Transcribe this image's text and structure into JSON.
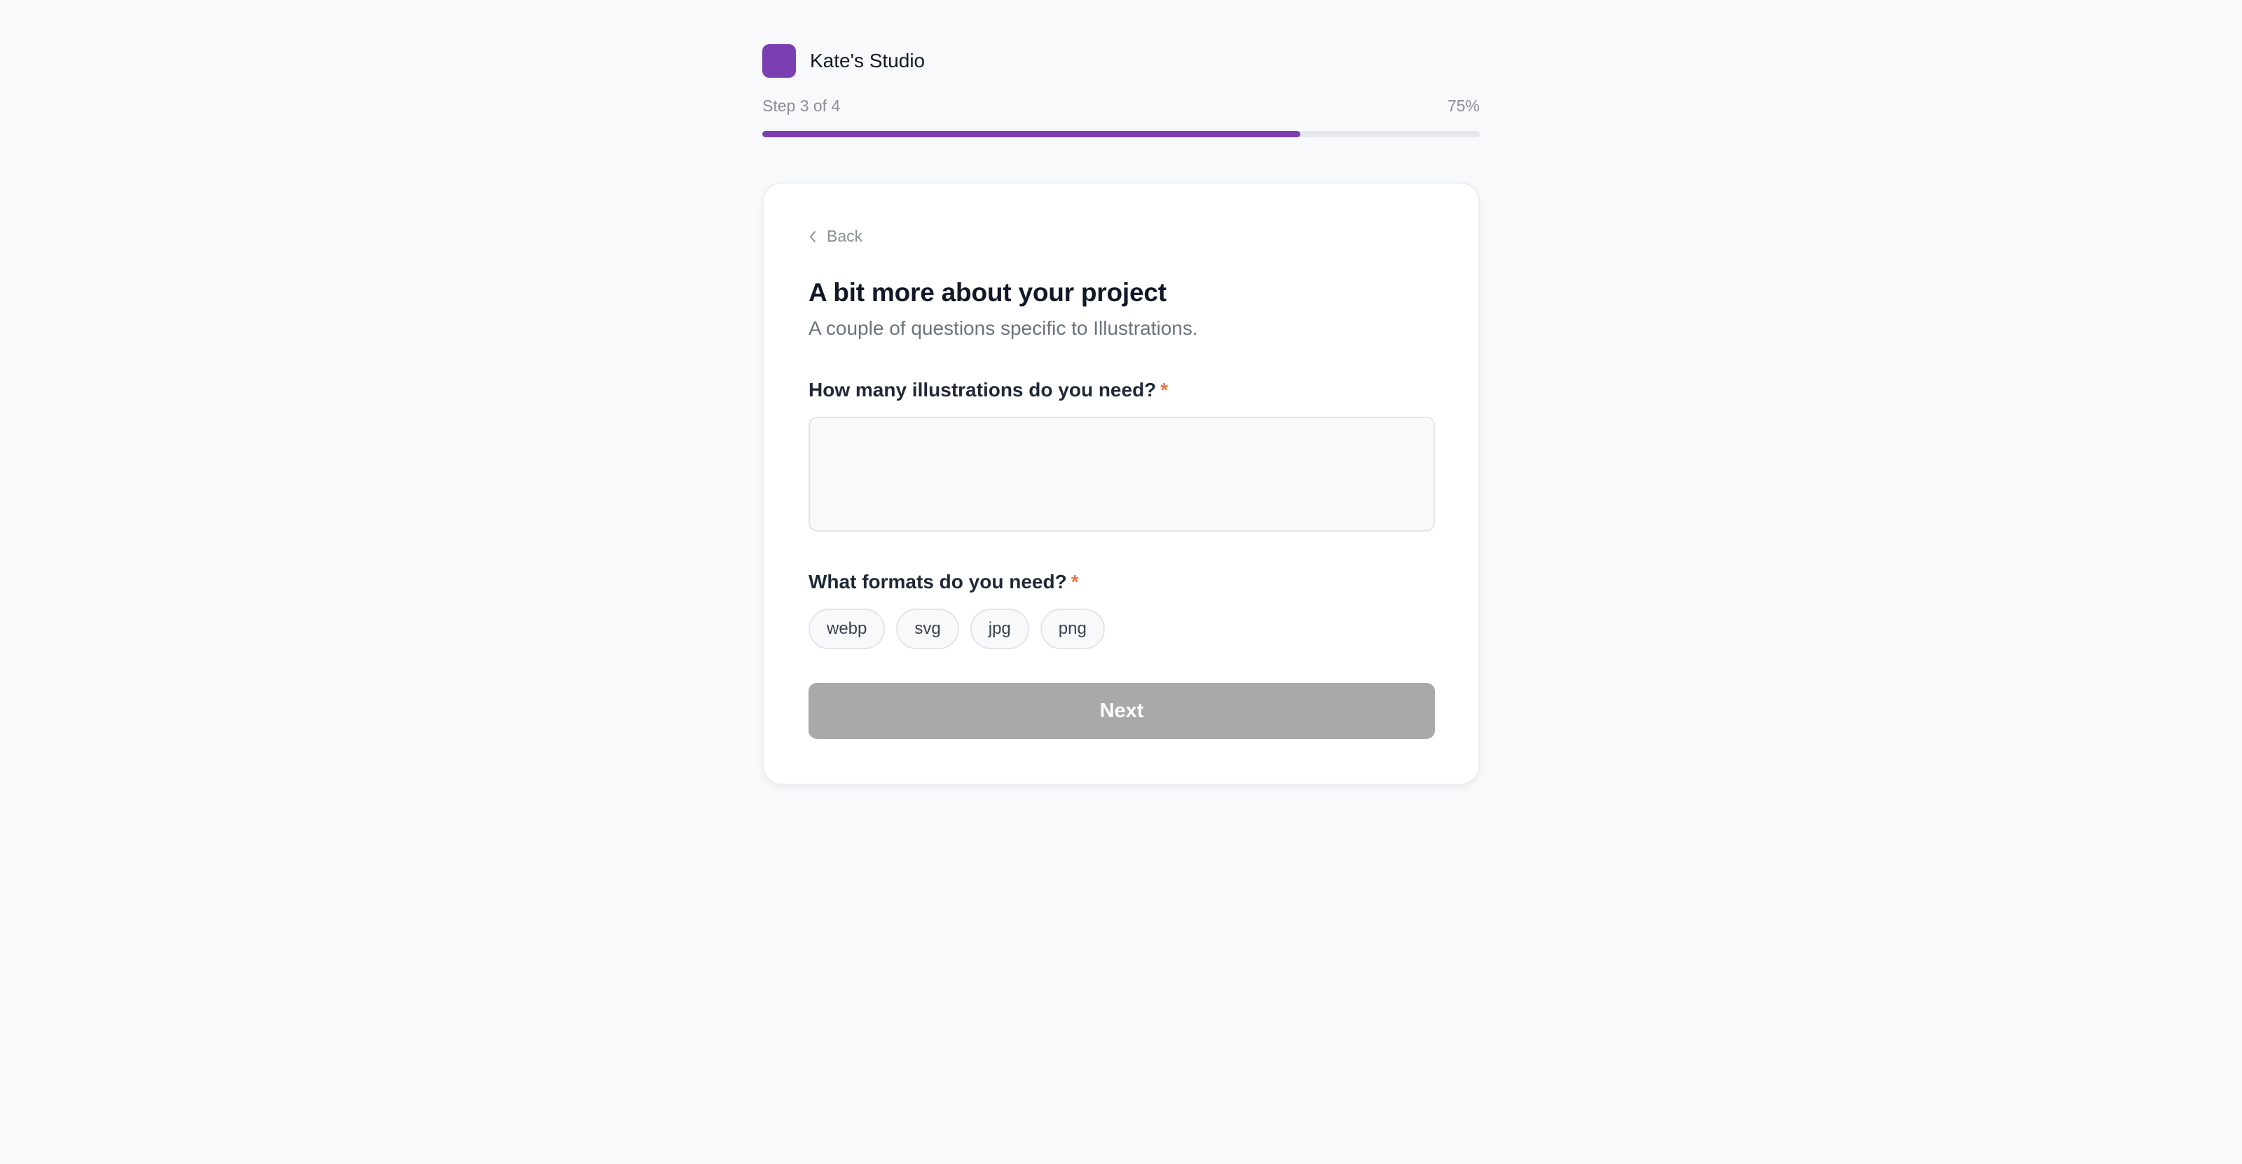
{
  "brand": {
    "name": "Kate's Studio",
    "color": "#7b3fb2",
    "icon": "studio-logo-square"
  },
  "progress": {
    "step_text": "Step 3 of 4",
    "percent_text": "75%",
    "fill_fraction": 0.75
  },
  "card": {
    "back_label": "Back",
    "back_icon": "chevron-left-icon",
    "title": "A bit more about your project",
    "subtitle": "A couple of questions specific to Illustrations.",
    "questions": [
      {
        "label": "How many illustrations do you need?",
        "required_mark": "*",
        "value": "",
        "placeholder": ""
      },
      {
        "label": "What formats do you need?",
        "required_mark": "*",
        "options": [
          "webp",
          "svg",
          "jpg",
          "png"
        ]
      }
    ],
    "next_label": "Next",
    "next_disabled": true
  },
  "colors": {
    "accent": "#7b3fb2",
    "required": "#e07a4a",
    "disabled_button": "#a9a9a9",
    "background": "#f8f9fa"
  }
}
